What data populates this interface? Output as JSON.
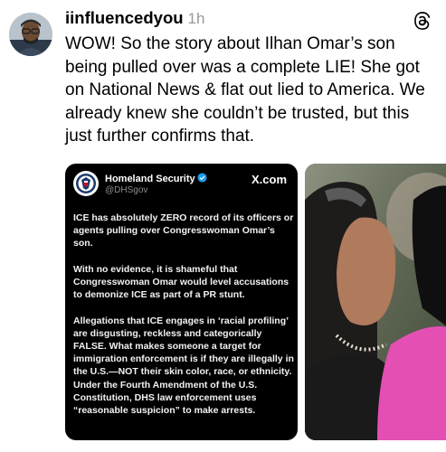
{
  "post": {
    "username": "iinfluencedyou",
    "time": "1h",
    "text": "WOW! So the story about Ilhan Omar’s son being pulled over was a complete LIE! She got on National News & flat out lied to America. We already knew she couldn’t be trusted, but this just further confirms that.",
    "avatar_icon": "user-avatar",
    "menu_icon": "threads-icon"
  },
  "embed": {
    "account_name": "Homeland Security",
    "handle": "@DHSgov",
    "source": "X.com",
    "paragraphs": [
      "ICE has absolutely ZERO record of its officers or agents pulling over Congresswoman Omar’s son.",
      "With no evidence, it is shameful that Congresswoman Omar would level accusations to demonize ICE as part of a PR stunt.",
      "Allegations that ICE engages in ‘racial profiling’ are disgusting, reckless and categorically FALSE. What makes someone a target for immigration enforcement is if they are illegally in the U.S.—NOT their skin color, race, or ethnicity. Under the Fourth Amendment of the U.S. Constitution, DHS law enforcement uses “reasonable suspicion” to make arrests."
    ]
  },
  "colors": {
    "text": "#000000",
    "muted": "#9a9a9a",
    "embed_bg": "#000000",
    "verified": "#1d9bf0"
  }
}
